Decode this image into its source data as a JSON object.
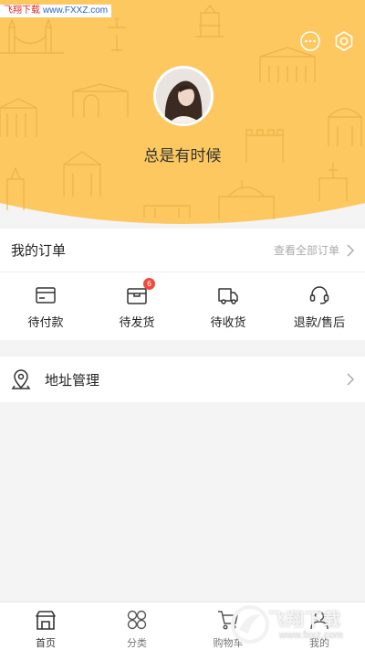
{
  "watermark": {
    "top_name": "飞翔下载",
    "top_url": "www.FXXZ.com",
    "bottom_name": "飞翔下载",
    "bottom_url": "www.fxxz.com"
  },
  "header": {
    "bg_color": "#fcc85f",
    "icons": [
      "message-icon",
      "settings-icon"
    ]
  },
  "profile": {
    "username": "总是有时候"
  },
  "orders": {
    "title": "我的订单",
    "view_all": "查看全部订单",
    "items": [
      {
        "label": "待付款",
        "icon": "card-icon",
        "badge": ""
      },
      {
        "label": "待发货",
        "icon": "box-icon",
        "badge": "6"
      },
      {
        "label": "待收货",
        "icon": "truck-icon",
        "badge": ""
      },
      {
        "label": "退款/售后",
        "icon": "headset-icon",
        "badge": ""
      }
    ]
  },
  "address": {
    "label": "地址管理",
    "icon": "location-pin-icon"
  },
  "tabbar": {
    "items": [
      {
        "label": "首页",
        "icon": "shop-icon",
        "active": true
      },
      {
        "label": "分类",
        "icon": "category-icon",
        "active": false
      },
      {
        "label": "购物车",
        "icon": "cart-icon",
        "active": false
      },
      {
        "label": "我的",
        "icon": "user-icon",
        "active": false
      }
    ]
  }
}
